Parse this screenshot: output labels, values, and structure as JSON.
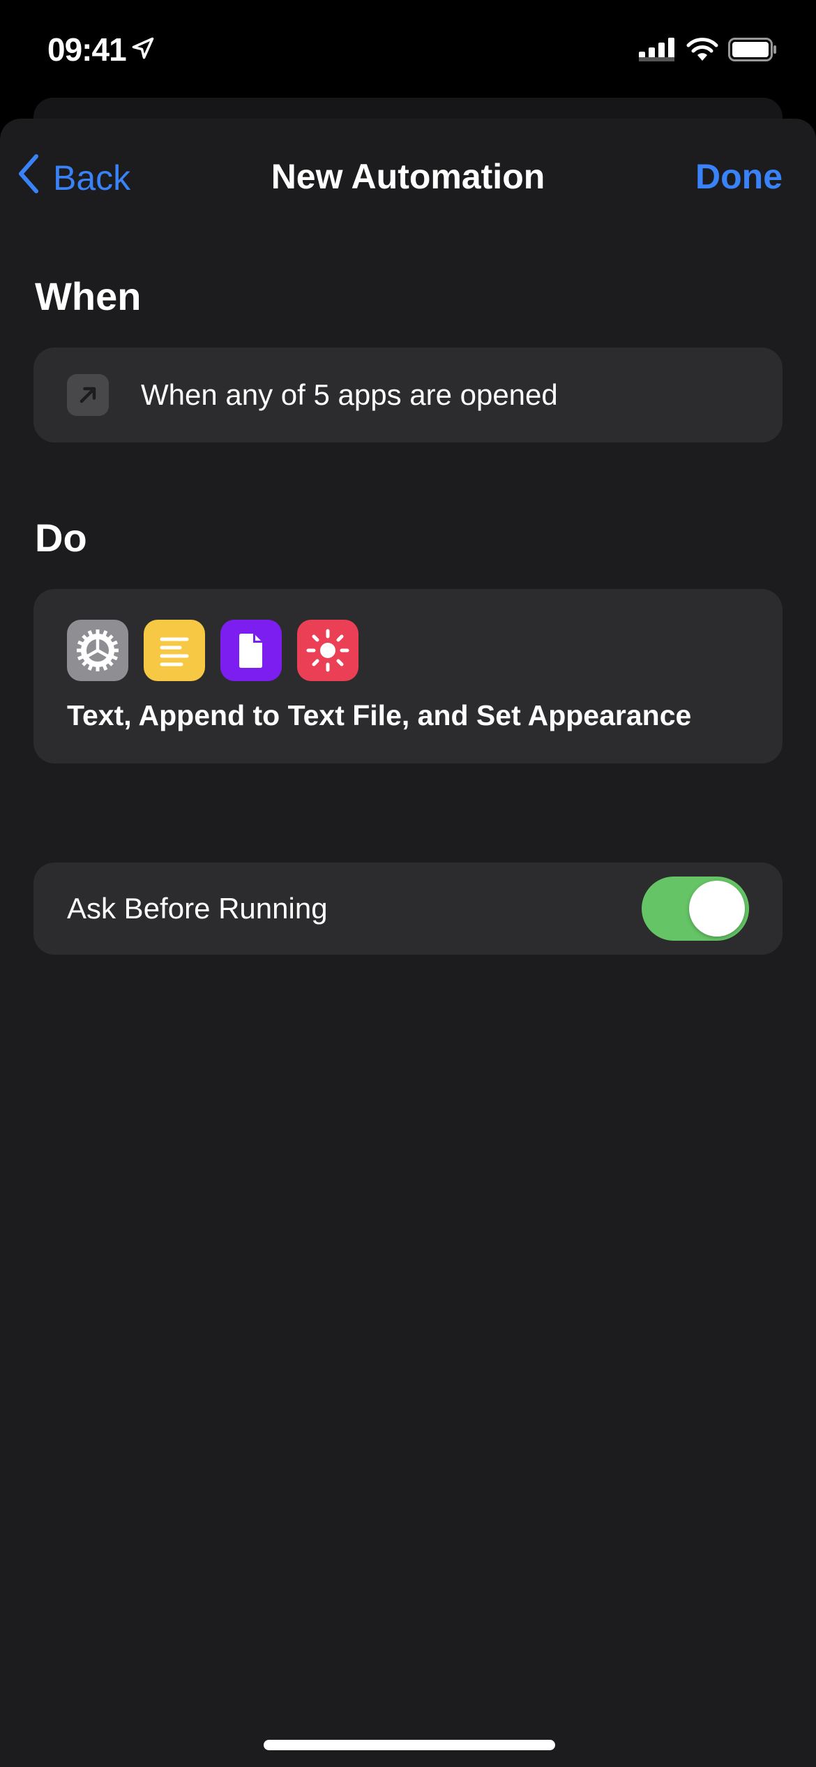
{
  "status_bar": {
    "time": "09:41",
    "icons": [
      "location-arrow-icon",
      "cellular-signal-icon",
      "wifi-icon",
      "battery-icon"
    ]
  },
  "nav": {
    "back_label": "Back",
    "title": "New Automation",
    "done_label": "Done",
    "accent_color": "#3a82f7"
  },
  "when": {
    "heading": "When",
    "trigger_icon": "arrow-up-right-icon",
    "trigger_text": "When any of 5 apps are opened"
  },
  "do": {
    "heading": "Do",
    "action_icons": [
      {
        "name": "settings-gear-icon",
        "color": "#8e8e93"
      },
      {
        "name": "text-lines-icon",
        "color": "#f7c843"
      },
      {
        "name": "document-icon",
        "color": "#7d1ef0"
      },
      {
        "name": "sun-brightness-icon",
        "color": "#ea3f55"
      }
    ],
    "summary": "Text, Append to Text File, and Set Appearance"
  },
  "ask_before_running": {
    "label": "Ask Before Running",
    "enabled": true,
    "on_color": "#65c466"
  }
}
